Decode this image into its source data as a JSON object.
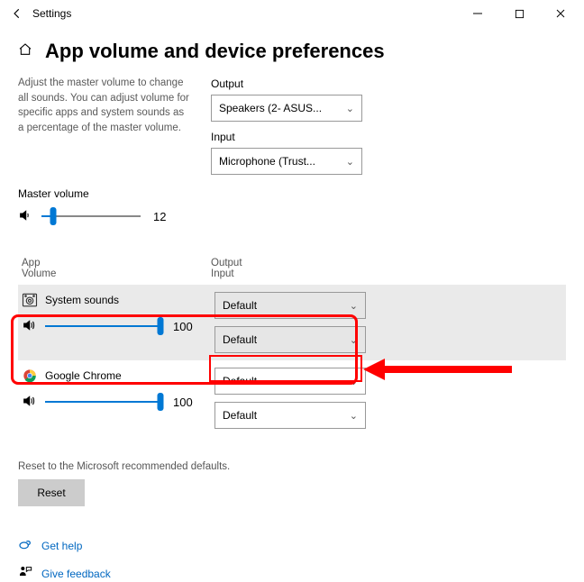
{
  "titlebar": {
    "title": "Settings"
  },
  "page_title": "App volume and device preferences",
  "description": "Adjust the master volume to change all sounds. You can adjust volume for specific apps and system sounds as a percentage of the master volume.",
  "output_label": "Output",
  "output_value": "Speakers (2- ASUS...",
  "input_label": "Input",
  "input_value": "Microphone (Trust...",
  "master_label": "Master volume",
  "master_value": "12",
  "col_app": "App",
  "col_volume": "Volume",
  "col_output": "Output",
  "col_input": "Input",
  "apps": [
    {
      "name": "System sounds",
      "volume": "100",
      "output": "Default",
      "input": "Default"
    },
    {
      "name": "Google Chrome",
      "volume": "100",
      "output": "Default",
      "input": "Default"
    }
  ],
  "reset_desc": "Reset to the Microsoft recommended defaults.",
  "reset_label": "Reset",
  "help_link": "Get help",
  "feedback_link": "Give feedback"
}
